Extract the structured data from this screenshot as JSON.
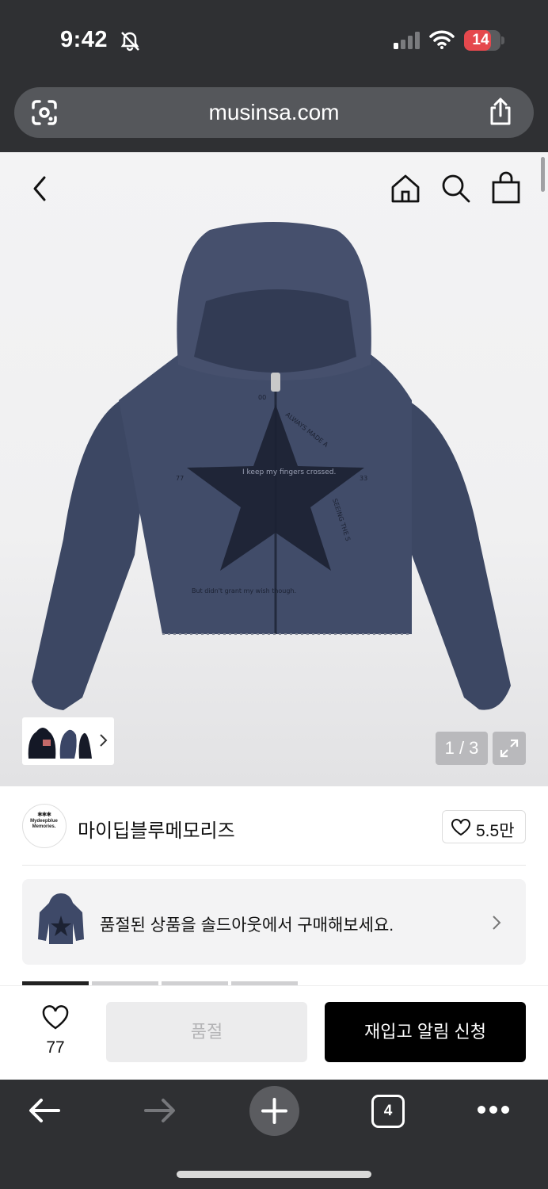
{
  "status_bar": {
    "time": "9:42",
    "battery": "14"
  },
  "browser": {
    "url": "musinsa.com",
    "tab_count": "4"
  },
  "gallery": {
    "counter": "1 / 3"
  },
  "print_text": {
    "top_number": "00",
    "left_number": "77",
    "right_number": "33",
    "arc_text": "ALWAYS MADE A",
    "arc_text_2": "SEEING THE S",
    "center_line": "I keep my fingers crossed.",
    "bottom_line": "But didn't grant my wish though."
  },
  "brand": {
    "name": "마이딥블루메모리즈",
    "logo_text_1": "Mydeepblue",
    "logo_text_2": "Memories.",
    "likes": "5.5만"
  },
  "promo": {
    "text": "품절된 상품을 솔드아웃에서 구매해보세요."
  },
  "buy_bar": {
    "wish_count": "77",
    "soldout_label": "품절",
    "restock_label": "재입고 알림 신청"
  },
  "colors": {
    "hoodie": "#3f4a66",
    "accent_black": "#000000",
    "battery_low": "#e5484d"
  }
}
